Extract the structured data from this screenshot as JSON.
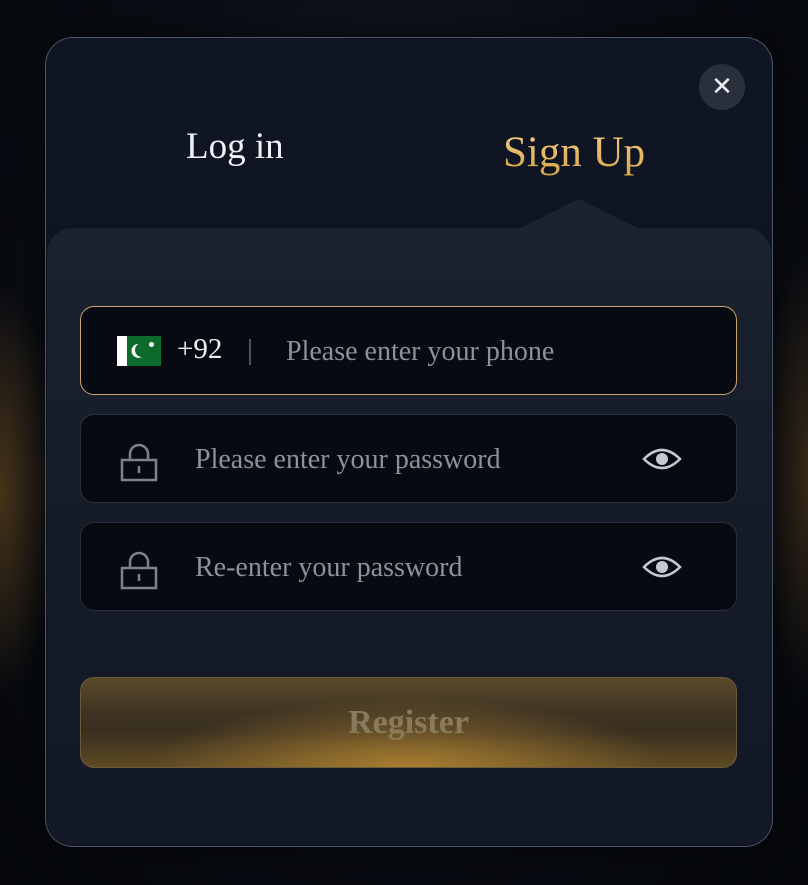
{
  "modal": {
    "close_symbol": "✕",
    "tabs": {
      "login": "Log in",
      "signup": "Sign Up",
      "active": "signup"
    }
  },
  "phone_field": {
    "country_flag": "pakistan-flag",
    "dial_code": "+92",
    "placeholder": "Please enter your phone"
  },
  "password_field": {
    "placeholder": "Please enter your password",
    "icon": "lock-icon",
    "toggle_icon": "eye-icon"
  },
  "confirm_password_field": {
    "placeholder": "Re-enter your password",
    "icon": "lock-icon",
    "toggle_icon": "eye-icon"
  },
  "register_button": {
    "label": "Register",
    "disabled": true
  },
  "colors": {
    "accent_gold": "#e2b661",
    "modal_bg": "#0f1522",
    "field_bg": "#070a11",
    "active_border": "#c9a56c"
  }
}
